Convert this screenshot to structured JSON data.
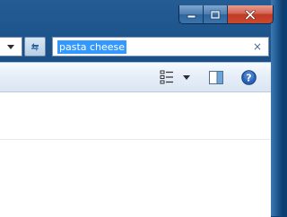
{
  "window": {
    "caption_buttons": [
      {
        "name": "minimize",
        "icon": "minimize-icon"
      },
      {
        "name": "maximize",
        "icon": "maximize-icon"
      },
      {
        "name": "close",
        "icon": "close-icon"
      }
    ]
  },
  "address_bar": {
    "dropdown_icon": "chevron-down-icon",
    "refresh_icon": "refresh-icon"
  },
  "search": {
    "value": "pasta cheese",
    "clear_glyph": "×"
  },
  "toolbar": {
    "views_icon": "details-view-icon",
    "views_dropdown_icon": "chevron-down-icon",
    "preview_pane_icon": "preview-pane-icon",
    "help_icon": "help-icon"
  },
  "colors": {
    "selection": "#3399ff",
    "frame": "#174c84",
    "close_button": "#c9472f"
  }
}
